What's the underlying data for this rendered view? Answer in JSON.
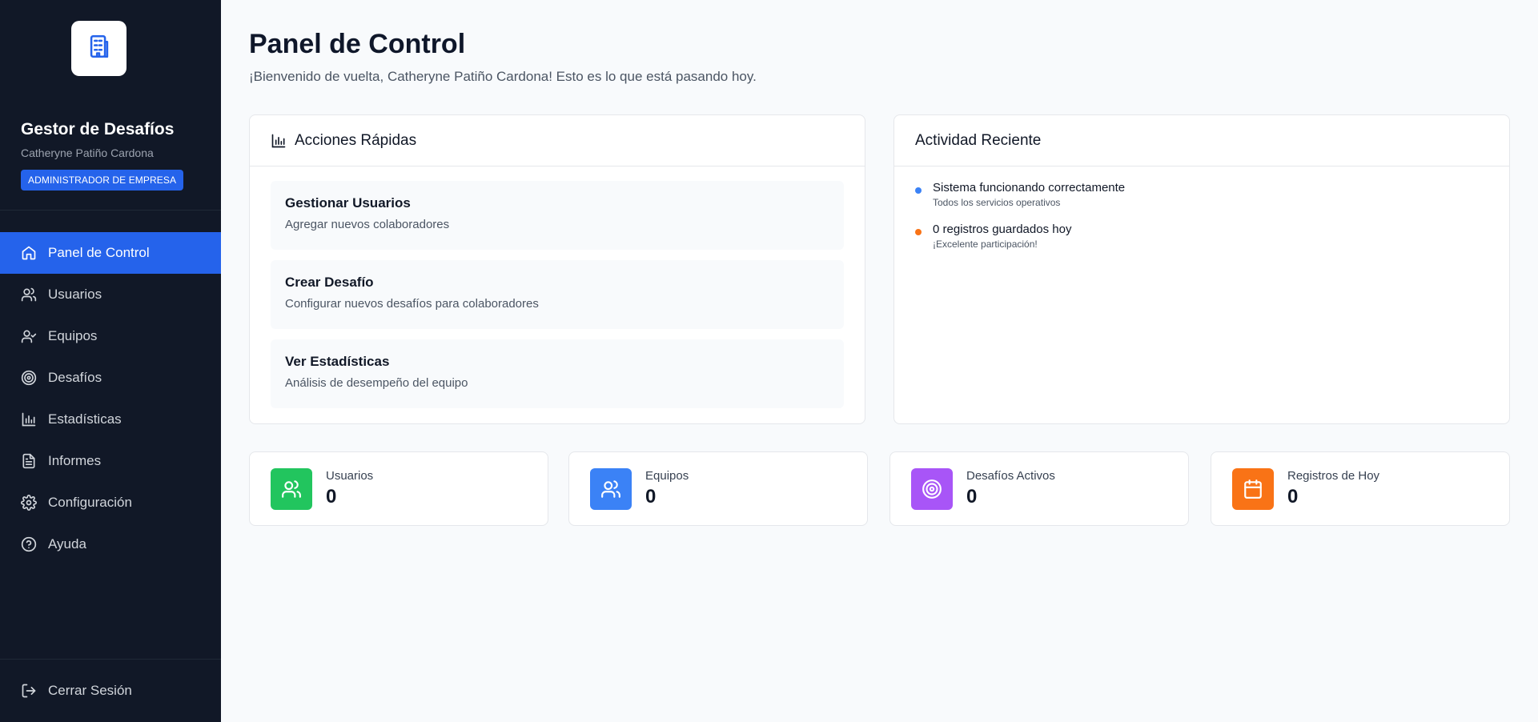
{
  "sidebar": {
    "logo_icon": "building-icon",
    "title": "Gestor de Desafíos",
    "user_name": "Catheryne Patiño Cardona",
    "role_badge": "ADMINISTRADOR DE EMPRESA",
    "nav_items": [
      {
        "label": "Panel de Control",
        "icon": "home-icon",
        "active": true
      },
      {
        "label": "Usuarios",
        "icon": "users-icon",
        "active": false
      },
      {
        "label": "Equipos",
        "icon": "user-check-icon",
        "active": false
      },
      {
        "label": "Desafíos",
        "icon": "target-icon",
        "active": false
      },
      {
        "label": "Estadísticas",
        "icon": "bar-chart-icon",
        "active": false
      },
      {
        "label": "Informes",
        "icon": "file-text-icon",
        "active": false
      },
      {
        "label": "Configuración",
        "icon": "gear-icon",
        "active": false
      },
      {
        "label": "Ayuda",
        "icon": "help-circle-icon",
        "active": false
      }
    ],
    "logout_label": "Cerrar Sesión"
  },
  "header": {
    "title": "Panel de Control",
    "subtitle": "¡Bienvenido de vuelta, Catheryne Patiño Cardona! Esto es lo que está pasando hoy."
  },
  "quick_actions": {
    "title": "Acciones Rápidas",
    "items": [
      {
        "title": "Gestionar Usuarios",
        "description": "Agregar nuevos colaboradores"
      },
      {
        "title": "Crear Desafío",
        "description": "Configurar nuevos desafíos para colaboradores"
      },
      {
        "title": "Ver Estadísticas",
        "description": "Análisis de desempeño del equipo"
      }
    ]
  },
  "recent_activity": {
    "title": "Actividad Reciente",
    "items": [
      {
        "title": "Sistema funcionando correctamente",
        "description": "Todos los servicios operativos",
        "dot_color": "#3b82f6"
      },
      {
        "title": "0 registros guardados hoy",
        "description": "¡Excelente participación!",
        "dot_color": "#f97316"
      }
    ]
  },
  "stats": [
    {
      "label": "Usuarios",
      "value": "0",
      "icon": "users-icon",
      "color": "#22c55e"
    },
    {
      "label": "Equipos",
      "value": "0",
      "icon": "users-icon",
      "color": "#3b82f6"
    },
    {
      "label": "Desafíos Activos",
      "value": "0",
      "icon": "target-icon",
      "color": "#a855f7"
    },
    {
      "label": "Registros de Hoy",
      "value": "0",
      "icon": "calendar-icon",
      "color": "#f97316"
    }
  ]
}
